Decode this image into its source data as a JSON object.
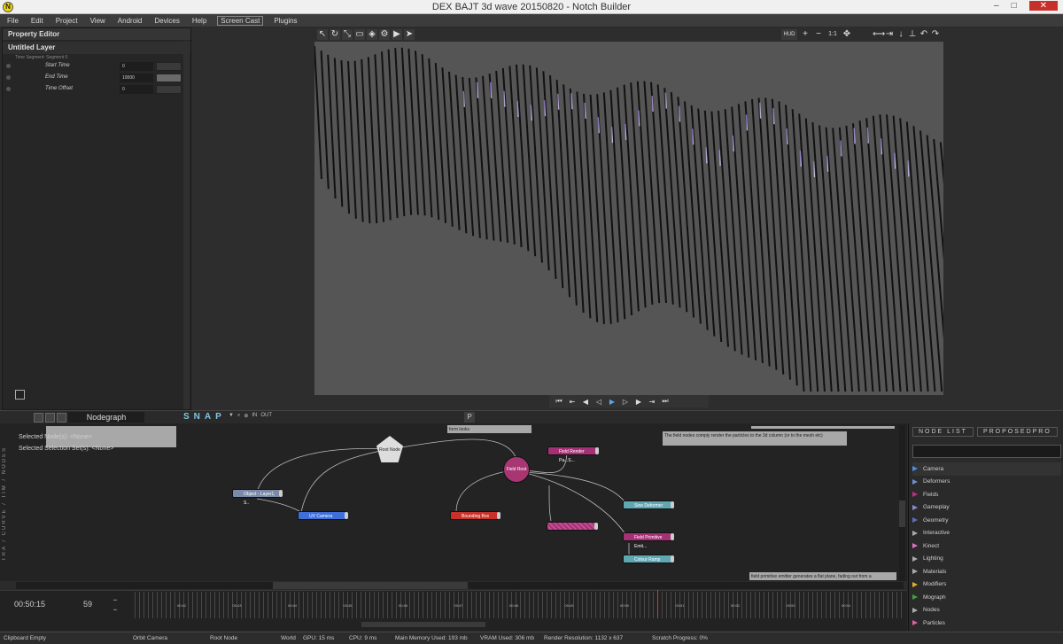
{
  "window": {
    "title": "DEX BAJT 3d wave 20150820 - Notch Builder",
    "controls": [
      "–",
      "□",
      "✕"
    ]
  },
  "menu": [
    "File",
    "Edit",
    "Project",
    "View",
    "Android",
    "Devices",
    "Help",
    "Screen Cast",
    "Plugins"
  ],
  "property_editor": {
    "header": "Property Editor",
    "layer_title": "Untitled Layer",
    "layer_sub": "Time Segment: Segment 0",
    "rows": [
      {
        "label": "Start Time",
        "value": "0"
      },
      {
        "label": "End Time",
        "value": "10000"
      },
      {
        "label": "Time Offset",
        "value": "0"
      }
    ]
  },
  "viewport_toolbar": {
    "hud": "HUD",
    "zoom_in": "+",
    "zoom_out": "−",
    "zoom_reset": "1:1"
  },
  "nodegraph": {
    "title": "Nodegraph",
    "snap": "SNAP",
    "in_label": "IN",
    "out_label": "OUT",
    "p_label": "P",
    "vertical_tabs": "TRA / CURVE / TIM / NODES",
    "selected_node": "Selected Node(s): <None>",
    "selected_set": "Selected Selection Set(s): <None>",
    "comment_1": "form looks",
    "comment_2": "The field nodes comply render the particles to the 3d column (or to the mesh etc)",
    "comment_3": "field primitive emitter generates a flat plane, fading out from a",
    "nodes": {
      "root": "Root Node",
      "field": "Field Root",
      "object_layer": "Object - Layer1, S..",
      "uv_camera": "UV Camera",
      "bounding_box": "Bounding Box",
      "field_render": "Field Render Pa...S...",
      "sine_deformer": "Sine Deformer",
      "field_primitive": "Field Primitive Emit...",
      "colour_ramp": "Colour Ramp"
    }
  },
  "node_list": {
    "tabs": [
      "NODE LIST",
      "PROPOSEDPRO"
    ],
    "items": [
      {
        "name": "Camera",
        "color": "#4a8fe0"
      },
      {
        "name": "Deformers",
        "color": "#6b8fd0"
      },
      {
        "name": "Fields",
        "color": "#c03080"
      },
      {
        "name": "Gameplay",
        "color": "#8a8ad0"
      },
      {
        "name": "Geometry",
        "color": "#5a70c0"
      },
      {
        "name": "Interactive",
        "color": "#aaaaaa"
      },
      {
        "name": "Kinect",
        "color": "#e070c0"
      },
      {
        "name": "Lighting",
        "color": "#aaaaaa"
      },
      {
        "name": "Materials",
        "color": "#aaaaaa"
      },
      {
        "name": "Modifiers",
        "color": "#e0b030"
      },
      {
        "name": "Mograph",
        "color": "#40a040"
      },
      {
        "name": "Nodes",
        "color": "#aaaaaa"
      },
      {
        "name": "Particles",
        "color": "#e060a0"
      }
    ]
  },
  "timeline": {
    "time": "00:50:15",
    "frame": "59",
    "ticks": [
      "00:42",
      "00:43",
      "00:44",
      "00:45",
      "00:46",
      "00:47",
      "00:48",
      "00:49",
      "00:50",
      "00:51",
      "00:52",
      "00:53",
      "00:54"
    ]
  },
  "status": {
    "clipboard": "Clipboard Empty",
    "camera": "Orbit Camera",
    "node": "Root Node",
    "space": "World",
    "gpu": "GPU: 15 ms",
    "cpu": "CPU: 9 ms",
    "memory": "Main Memory Used: 193 mb",
    "vram": "VRAM Used: 306 mb",
    "resolution": "Render Resolution: 1132 x 637",
    "scratch": "Scratch Progress: 0%"
  }
}
